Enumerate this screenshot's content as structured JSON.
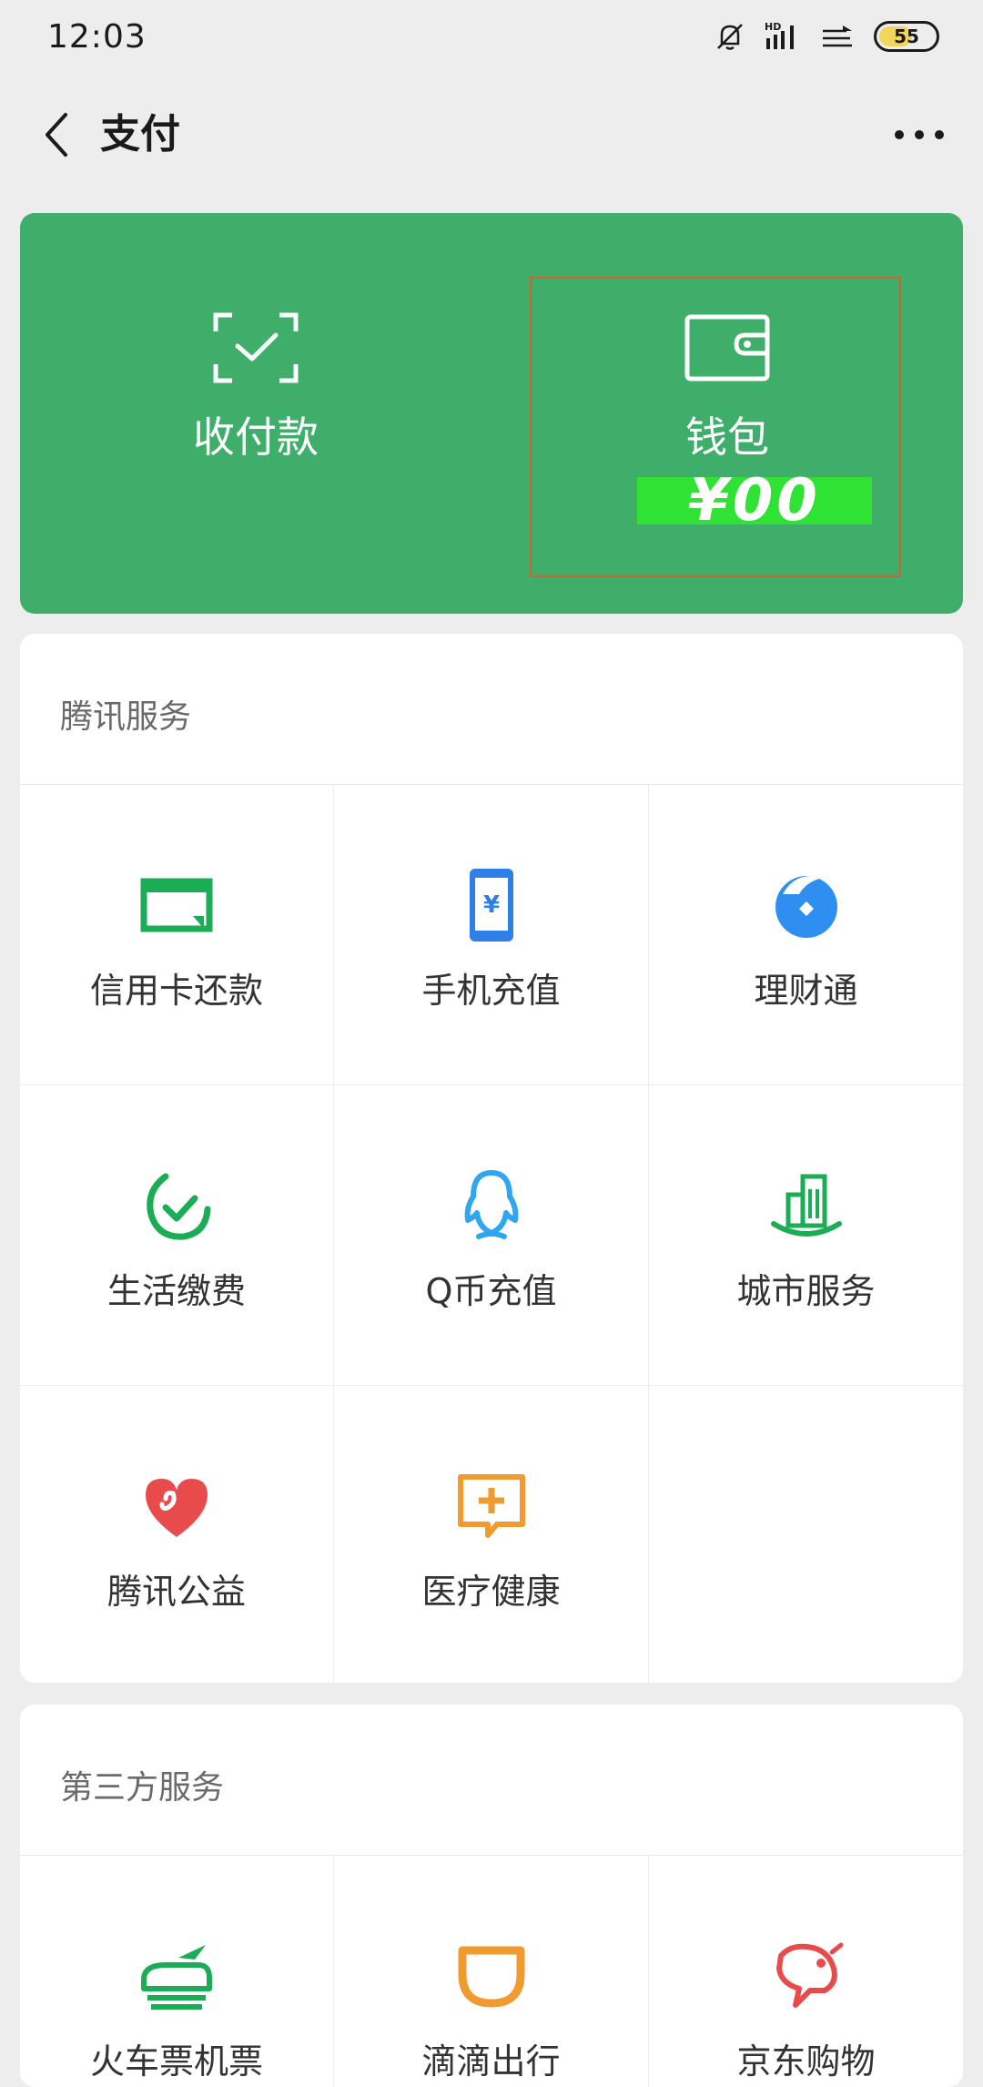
{
  "status_bar": {
    "time": "12:03",
    "battery": "55",
    "icons": [
      "mute-bell-icon",
      "hd-signal-icon",
      "wifi-icon",
      "battery-icon"
    ]
  },
  "header": {
    "title": "支付",
    "back_icon": "chevron-left-icon",
    "more_icon": "more-dots-icon"
  },
  "pay_card": {
    "receive_label": "收付款",
    "receive_icon": "scan-check-icon",
    "wallet_label": "钱包",
    "wallet_icon": "wallet-icon",
    "wallet_balance": "¥00",
    "accent": "#3fae6a"
  },
  "tencent_services": {
    "title": "腾讯服务",
    "items": [
      {
        "label": "信用卡还款",
        "icon": "credit-card-icon",
        "color": "#1aad55"
      },
      {
        "label": "手机充值",
        "icon": "phone-recharge-icon",
        "color": "#2f7fe8"
      },
      {
        "label": "理财通",
        "icon": "wealth-icon",
        "color": "#2f8ff0"
      },
      {
        "label": "生活缴费",
        "icon": "bill-check-icon",
        "color": "#1aad55"
      },
      {
        "label": "Q币充值",
        "icon": "qq-penguin-icon",
        "color": "#2fa7f0"
      },
      {
        "label": "城市服务",
        "icon": "city-buildings-icon",
        "color": "#1aad55"
      },
      {
        "label": "腾讯公益",
        "icon": "charity-heart-icon",
        "color": "#e84b4b"
      },
      {
        "label": "医疗健康",
        "icon": "medical-chat-icon",
        "color": "#f09a2f"
      }
    ]
  },
  "third_party_services": {
    "title": "第三方服务",
    "items": [
      {
        "label": "火车票机票",
        "icon": "train-plane-icon",
        "color": "#1aad55"
      },
      {
        "label": "滴滴出行",
        "icon": "didi-icon",
        "color": "#f09a2f"
      },
      {
        "label": "京东购物",
        "icon": "jd-dog-icon",
        "color": "#e84b4b"
      }
    ]
  }
}
